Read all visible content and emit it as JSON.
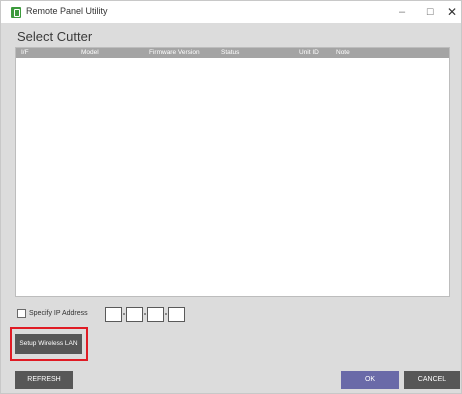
{
  "window": {
    "title": "Remote Panel Utility",
    "controls": {
      "minimize": "–",
      "maximize": "☐",
      "close": "✕"
    }
  },
  "section_title": "Select Cutter",
  "table": {
    "columns": [
      "I/F",
      "Model",
      "Firmware Version",
      "Status",
      "Unit ID",
      "Note"
    ],
    "rows": []
  },
  "ip": {
    "checkbox_label": "Specify IP Address",
    "checked": false,
    "octets": [
      "",
      "",
      "",
      ""
    ]
  },
  "buttons": {
    "setup_wlan": "Setup Wireless LAN",
    "refresh": "REFRESH",
    "ok": "OK",
    "cancel": "CANCEL"
  },
  "colors": {
    "window_bg": "#dcdcdc",
    "header_bg": "#a4a4a4",
    "button_bg": "#575757",
    "ok_bg": "#6a6aa8",
    "highlight": "#e01b24"
  }
}
